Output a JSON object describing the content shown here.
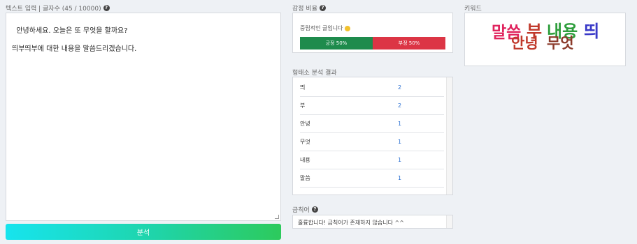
{
  "text_input": {
    "label": "텍스트 입력 | 글자수 (45 / 10000)",
    "value": "안녕하세요. 오늘은 또 무엇을 할까요?\n\n띄부띄부에 대한 내용을 말씀드리겠습니다."
  },
  "analyze_button": {
    "label": "분석"
  },
  "sentiment": {
    "label": "감정 비율",
    "summary": "중립적인 글입니다",
    "positive_label": "긍정 50%",
    "negative_label": "부정 50%",
    "positive_ratio": 0.5,
    "negative_ratio": 0.5,
    "colors": {
      "positive": "#1e8b4c",
      "negative": "#dc3545"
    }
  },
  "morph": {
    "label": "형태소 분석 결과",
    "rows": [
      {
        "word": "띄",
        "count": "2"
      },
      {
        "word": "부",
        "count": "2"
      },
      {
        "word": "안녕",
        "count": "1"
      },
      {
        "word": "무엇",
        "count": "1"
      },
      {
        "word": "내용",
        "count": "1"
      },
      {
        "word": "말씀",
        "count": "1"
      }
    ]
  },
  "profanity": {
    "label": "금칙어",
    "message": "훌륭합니다! 금칙어가 존재하지 않습니다 ^^"
  },
  "keywords": {
    "label": "키워드",
    "words": [
      {
        "text": "말씀",
        "color": "#e0245e"
      },
      {
        "text": "부",
        "color": "#c0392b"
      },
      {
        "text": "내용",
        "color": "#2e9e3c"
      },
      {
        "text": "띄",
        "color": "#3a3ac8"
      },
      {
        "text": "안녕",
        "color": "#c0392b"
      },
      {
        "text": "무엇",
        "color": "#8b3a2a"
      }
    ]
  }
}
